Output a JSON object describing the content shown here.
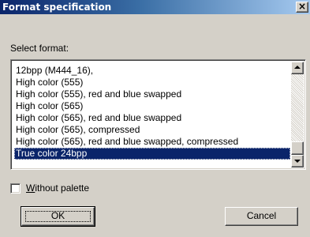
{
  "window": {
    "title": "Format specification",
    "close_glyph": "×"
  },
  "main": {
    "select_label": "Select format:",
    "formats": [
      "12bpp (M444_16),",
      "High color (555)",
      "High color (555), red and blue swapped",
      "High color (565)",
      "High color (565), red and blue swapped",
      "High color (565), compressed",
      "High color (565), red and blue swapped, compressed",
      "True color 24bpp"
    ],
    "selected_format": "True color 24bpp"
  },
  "options": {
    "without_palette": {
      "accel": "W",
      "rest": "ithout palette",
      "checked": false
    }
  },
  "buttons": {
    "ok_label": "OK",
    "cancel_label": "Cancel"
  },
  "colors": {
    "dialog_bg": "#d4d0c8",
    "title_start": "#0a246a",
    "title_end": "#a6caf0",
    "selection_bg": "#0a246a"
  },
  "icons": {
    "close": "close-icon",
    "scroll_up": "arrow-up-icon",
    "scroll_down": "arrow-down-icon"
  }
}
